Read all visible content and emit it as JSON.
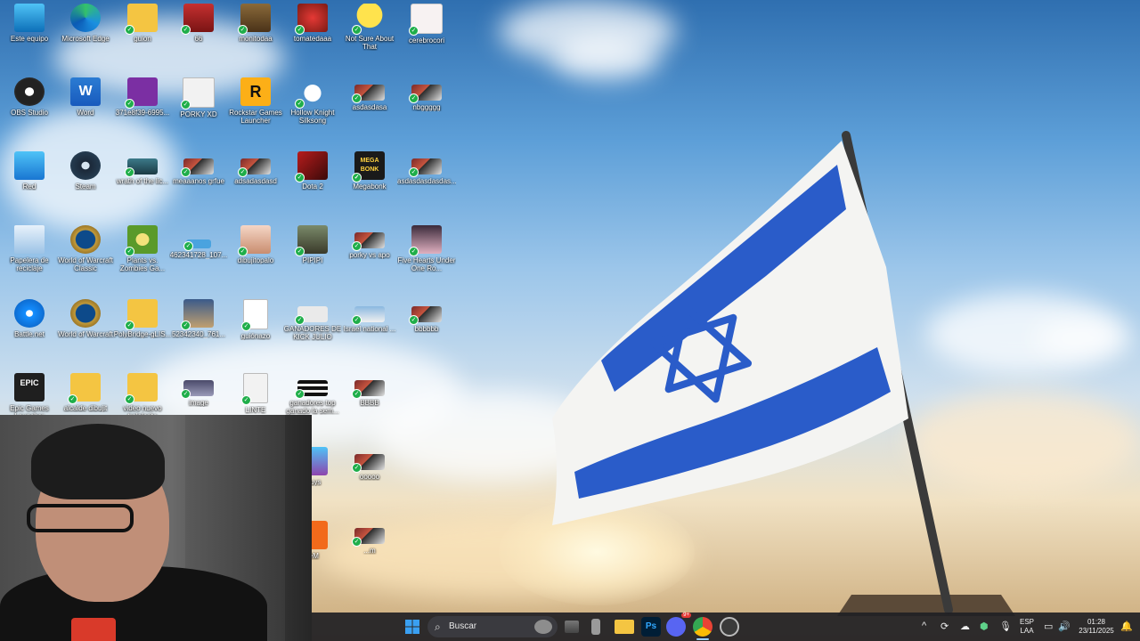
{
  "desktop": {
    "icons": [
      {
        "label": "Este equipo"
      },
      {
        "label": "Microsoft Edge"
      },
      {
        "label": "guion"
      },
      {
        "label": "66"
      },
      {
        "label": "monitodaa"
      },
      {
        "label": "tomatedaaa"
      },
      {
        "label": "Not Sure About That"
      },
      {
        "label": "cerebrocori"
      },
      {
        "label": "OBS Studio"
      },
      {
        "label": "Word"
      },
      {
        "label": "371e8f39-6995..."
      },
      {
        "label": "PORKY XD"
      },
      {
        "label": "Rockstar Games Launcher"
      },
      {
        "label": "Hollow Knight Silksong"
      },
      {
        "label": "asdasdasa"
      },
      {
        "label": "nbggggg"
      },
      {
        "label": "Red"
      },
      {
        "label": "Steam"
      },
      {
        "label": "wrath of the lic..."
      },
      {
        "label": "meaaanos grfue"
      },
      {
        "label": "adsadasdasd"
      },
      {
        "label": "Dota 2"
      },
      {
        "label": "Megabonk"
      },
      {
        "label": "asdasdasdasdas..."
      },
      {
        "label": "Papelera de reciclaje"
      },
      {
        "label": "World of Warcraft Classic"
      },
      {
        "label": "Plants vs. Zombies Ga..."
      },
      {
        "label": "462341728_107..."
      },
      {
        "label": "dibujitopalo"
      },
      {
        "label": "PIPIPI"
      },
      {
        "label": "porky vs apo"
      },
      {
        "label": "Five Hearts Under One Ro..."
      },
      {
        "label": "Battle.net"
      },
      {
        "label": "World of Warcraft"
      },
      {
        "label": "PolyBridge-gLIS..."
      },
      {
        "label": "52342340_761..."
      },
      {
        "label": "guiónazo"
      },
      {
        "label": "GANADORES DE KICK JULIO"
      },
      {
        "label": "Israel national ..."
      },
      {
        "label": "bbbbbb"
      },
      {
        "label": "Epic Games Launcher"
      },
      {
        "label": "alcalde dibujit"
      },
      {
        "label": "video nuevo tralalerito"
      },
      {
        "label": "image"
      },
      {
        "label": "LINTE"
      },
      {
        "label": "ganadores top ganado la sem..."
      },
      {
        "label": "BBBB"
      },
      {
        "label": "Guys"
      },
      {
        "label": "ooooo"
      },
      {
        "label": "reM"
      },
      {
        "label": "...m"
      }
    ]
  },
  "taskbar": {
    "search_placeholder": "Buscar",
    "language_top": "ESP",
    "language_bottom": "LAA",
    "time": "01:28",
    "date": "23/11/2025",
    "discord_badge": "9+"
  }
}
